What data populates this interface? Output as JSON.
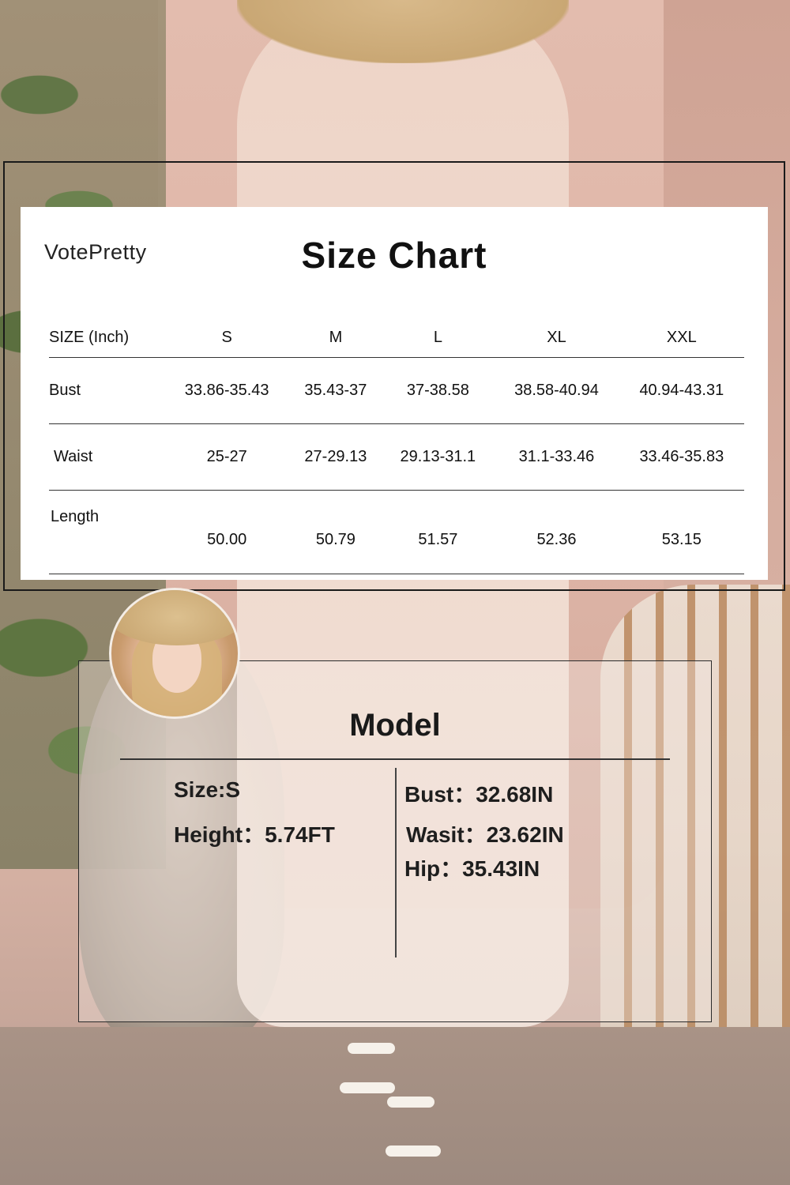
{
  "brand": "VotePretty",
  "size_chart": {
    "title": "Size Chart",
    "header_label": "SIZE (Inch)",
    "sizes": [
      "S",
      "M",
      "L",
      "XL",
      "XXL"
    ],
    "rows": [
      {
        "label": "Bust",
        "values": [
          "33.86-35.43",
          "35.43-37",
          "37-38.58",
          "38.58-40.94",
          "40.94-43.31"
        ]
      },
      {
        "label": "Waist",
        "values": [
          "25-27",
          "27-29.13",
          "29.13-31.1",
          "31.1-33.46",
          "33.46-35.83"
        ]
      },
      {
        "label": "Length",
        "values": [
          "50.00",
          "50.79",
          "51.57",
          "52.36",
          "53.15"
        ]
      }
    ]
  },
  "model": {
    "title": "Model",
    "size": "Size:S",
    "height": "Height：5.74FT",
    "bust": "Bust：32.68IN",
    "waist": "Wasit：23.62IN",
    "hip": "Hip：35.43IN"
  }
}
